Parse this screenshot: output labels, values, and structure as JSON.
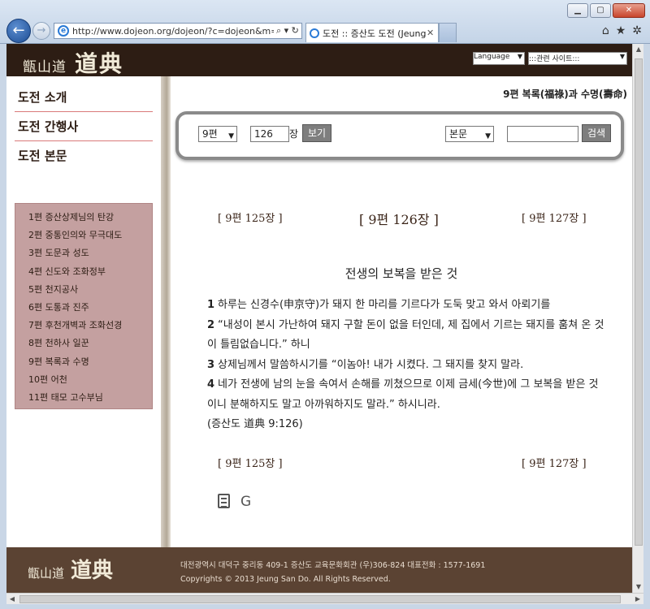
{
  "browser": {
    "url": "http://www.dojeon.org/dojeon/?c=dojeon&m=read&p",
    "address_controls": "⌕ ▾ ↻",
    "tab_title": "도전 :: 증산도 도전 (Jeung...",
    "tab_close": "✕",
    "back": "←",
    "forward": "→",
    "tools": [
      "⌂",
      "★",
      "✲"
    ],
    "window_buttons": [
      "▁",
      "▢",
      "✕"
    ]
  },
  "header": {
    "logo_small": "甑山道",
    "logo_big": "道典",
    "language_select": "Language",
    "site_select": ":::관련 사이트:::"
  },
  "sidebar": {
    "menu": [
      "도전 소개",
      "도전 간행사",
      "도전 본문"
    ],
    "submenu": [
      "1편 증산상제님의 탄강",
      "2편 중통인의와 무극대도",
      "3편 도문과 성도",
      "4편 신도와 조화정부",
      "5편 천지공사",
      "6편 도통과 진주",
      "7편 후천개벽과 조화선경",
      "8편 천하사 일꾼",
      "9편 복록과 수명",
      "10편 어천",
      "11편 태모 고수부님"
    ]
  },
  "content": {
    "chapter_title": "9편 복록(福祿)과 수명(壽命)",
    "search": {
      "volume_select": "9편",
      "chapter_value": "126",
      "chapter_unit": "장",
      "view_button": "보기",
      "scope_select": "본문",
      "query_value": "",
      "search_button": "검색"
    },
    "prev_link": "[ 9편 125장 ]",
    "current": "[ 9편 126장 ]",
    "next_link": "[ 9편 127장 ]",
    "verse_title": "전생의 보복을 받은 것",
    "verses": [
      {
        "num": "1",
        "text": "하루는 신경수(申京守)가 돼지 한 마리를 기르다가 도둑 맞고 와서 아뢰기를"
      },
      {
        "num": "2",
        "text": "“내성이 본시 가난하여 돼지 구할 돈이 없을 터인데, 제 집에서 기르는 돼지를 훔쳐 온 것이 틀림없습니다.” 하니"
      },
      {
        "num": "3",
        "text": "상제님께서 말씀하시기를 “이놈아! 내가 시켰다. 그 돼지를 찾지 말라."
      },
      {
        "num": "4",
        "text": "네가 전생에 남의 눈을 속여서 손해를 끼쳤으므로 이제 금세(今世)에 그 보복을 받은 것이니 분해하지도 말고 아까워하지도 말라.” 하시니라."
      }
    ],
    "source": "(증산도 道典 9:126)",
    "prev_link_bottom": "[ 9편 125장 ]",
    "next_link_bottom": "[ 9편 127장 ]",
    "g_label": "G"
  },
  "footer": {
    "logo_small": "甑山道",
    "logo_big": "道典",
    "address": "대전광역시 대덕구 중리동 409-1 증산도 교육문화회관 (우)306-824 대표전화 : 1577-1691",
    "copyright": "Copyrights © 2013 Jeung San Do. All Rights Reserved."
  }
}
